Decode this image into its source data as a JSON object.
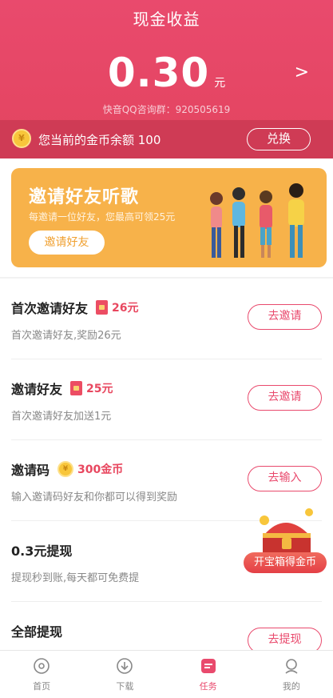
{
  "header": {
    "title": "现金收益",
    "amount": "0.30",
    "unit": "元",
    "qq_group": "快音QQ咨询群：920505619",
    "arrow": ">"
  },
  "coin_bar": {
    "coin_glyph": "¥",
    "text": "您当前的金币余额 100",
    "exchange_label": "兑换"
  },
  "banner": {
    "title": "邀请好友听歌",
    "subtitle": "每邀请一位好友，您最高可领25元",
    "button": "邀请好友"
  },
  "tasks": [
    {
      "title": "首次邀请好友",
      "reward": "26元",
      "reward_icon": "red-envelope-icon",
      "desc": "首次邀请好友,奖励26元",
      "button": "去邀请"
    },
    {
      "title": "邀请好友",
      "reward": "25元",
      "reward_icon": "red-envelope-icon",
      "desc": "首次邀请好友加送1元",
      "button": "去邀请"
    },
    {
      "title": "邀请码",
      "reward": "300金币",
      "reward_icon": "coin-icon",
      "desc": "输入邀请码好友和你都可以得到奖励",
      "button": "去输入"
    },
    {
      "title": "0.3元提现",
      "reward": "",
      "reward_icon": "",
      "desc": "提现秒到账,每天都可免费提",
      "button": ""
    },
    {
      "title": "全部提现",
      "reward": "",
      "reward_icon": "",
      "desc": "",
      "button": "去提现"
    }
  ],
  "treasure": {
    "label": "开宝箱得金币"
  },
  "tabbar": [
    {
      "label": "首页",
      "icon": "home-disc-icon"
    },
    {
      "label": "下载",
      "icon": "download-icon"
    },
    {
      "label": "任务",
      "icon": "task-icon",
      "active": true
    },
    {
      "label": "我的",
      "icon": "profile-icon"
    }
  ],
  "colors": {
    "primary": "#e94a6d",
    "banner": "#f7b24a",
    "coin": "#f8c63b"
  }
}
